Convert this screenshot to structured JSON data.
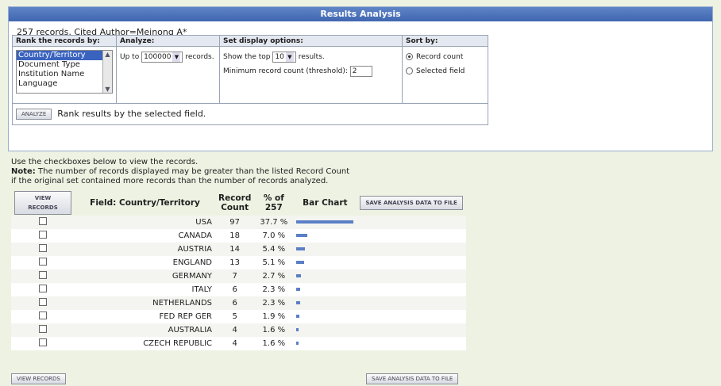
{
  "title": "Results Analysis",
  "summary": "257 records. Cited Author=Meinong A*",
  "options": {
    "rank_header": "Rank the records by:",
    "analyze_header": "Analyze:",
    "display_header": "Set display options:",
    "sort_header": "Sort by:",
    "rank_items": [
      "Country/Territory",
      "Document Type",
      "Institution Name",
      "Language"
    ],
    "up_to_prefix": "Up to",
    "up_to_value": "100000",
    "up_to_suffix": "records.",
    "show_top_prefix": "Show the top",
    "show_top_value": "10",
    "show_top_suffix": "results.",
    "threshold_label": "Minimum record count (threshold):",
    "threshold_value": "2",
    "sort_options": [
      "Record count",
      "Selected field"
    ],
    "analyze_button": "Analyze",
    "analyze_hint": "Rank results by the selected field."
  },
  "notes": {
    "line1": "Use the checkboxes below to view the records.",
    "note_label": "Note:",
    "line2": " The number of records displayed may be greater than the listed Record Count",
    "line3": "if the original set contained more records than the number of records analyzed."
  },
  "results": {
    "view_button": "View Records",
    "save_button": "Save Analysis Data to File",
    "field_header": "Field: Country/Territory",
    "count_header": "Record Count",
    "pct_header": "% of 257",
    "bar_header": "Bar Chart",
    "rows": [
      {
        "field": "USA",
        "count": "97",
        "pct": "37.7 %",
        "value": 37.7
      },
      {
        "field": "CANADA",
        "count": "18",
        "pct": "7.0 %",
        "value": 7.0
      },
      {
        "field": "AUSTRIA",
        "count": "14",
        "pct": "5.4 %",
        "value": 5.4
      },
      {
        "field": "ENGLAND",
        "count": "13",
        "pct": "5.1 %",
        "value": 5.1
      },
      {
        "field": "GERMANY",
        "count": "7",
        "pct": "2.7 %",
        "value": 2.7
      },
      {
        "field": "ITALY",
        "count": "6",
        "pct": "2.3 %",
        "value": 2.3
      },
      {
        "field": "NETHERLANDS",
        "count": "6",
        "pct": "2.3 %",
        "value": 2.3
      },
      {
        "field": "FED REP GER",
        "count": "5",
        "pct": "1.9 %",
        "value": 1.9
      },
      {
        "field": "AUSTRALIA",
        "count": "4",
        "pct": "1.6 %",
        "value": 1.6
      },
      {
        "field": "CZECH REPUBLIC",
        "count": "4",
        "pct": "1.6 %",
        "value": 1.6
      }
    ]
  },
  "colors": {
    "accent": "#3f66b0",
    "bar": "#5a7fc6"
  }
}
